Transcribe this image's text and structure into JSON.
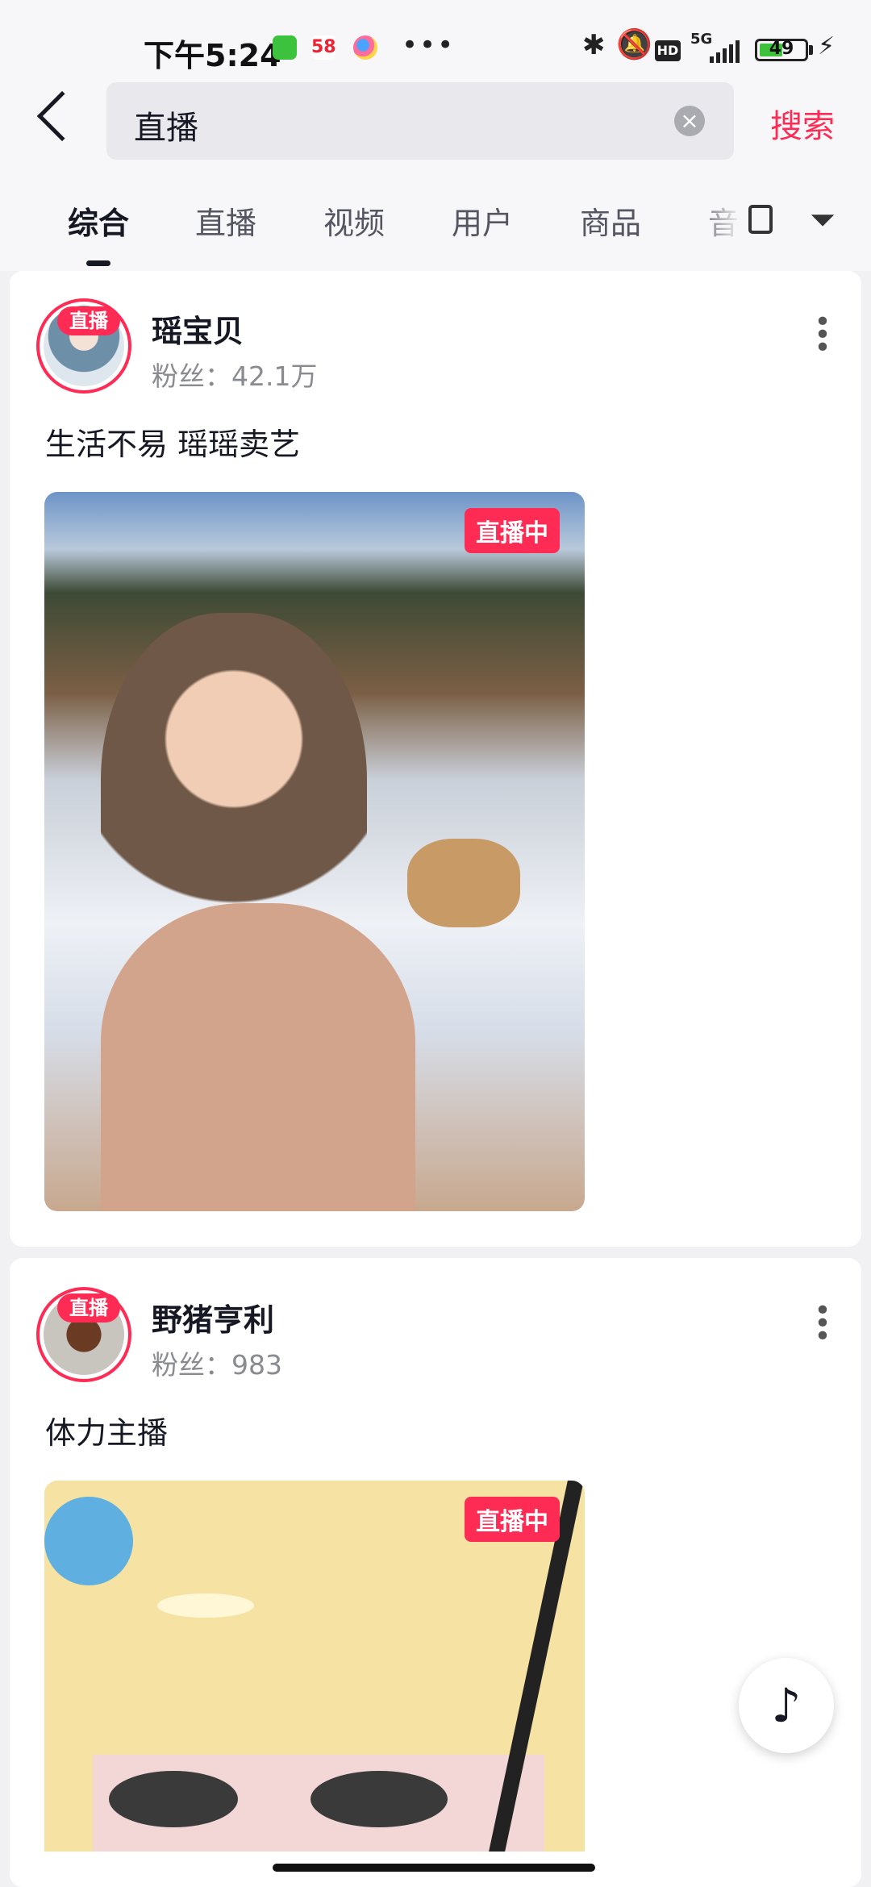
{
  "status_bar": {
    "time": "下午5:24",
    "app_58": "58",
    "dots": "•••",
    "network": "5G",
    "hd": "HD",
    "battery": "49"
  },
  "search": {
    "query": "直播",
    "search_button": "搜索"
  },
  "tabs": [
    "综合",
    "直播",
    "视频",
    "用户",
    "商品",
    "音"
  ],
  "results": [
    {
      "live_badge": "直播",
      "name": "瑶宝贝",
      "fans": "粉丝：42.1万",
      "description": "生活不易 瑶瑶卖艺",
      "live_tag": "直播中"
    },
    {
      "live_badge": "直播",
      "name": "野猪亨利",
      "fans": "粉丝：983",
      "description": "体力主播",
      "live_tag": "直播中"
    }
  ],
  "colors": {
    "accent": "#fe2c55",
    "text_primary": "#161823",
    "text_secondary": "#8a8b91"
  }
}
